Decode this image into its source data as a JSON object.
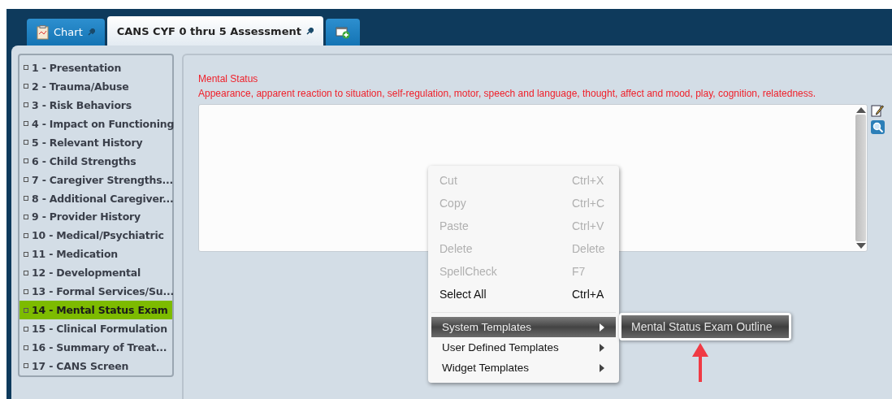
{
  "tabs": [
    {
      "label": "Chart",
      "selected": false,
      "kind": "chart"
    },
    {
      "label": "CANS CYF 0 thru 5 Assessment",
      "selected": true,
      "kind": "form"
    },
    {
      "kind": "add",
      "selected": false
    }
  ],
  "sidebar": {
    "items": [
      {
        "label": "1 - Presentation",
        "selected": false
      },
      {
        "label": "2 - Trauma/Abuse",
        "selected": false
      },
      {
        "label": "3 - Risk Behaviors",
        "selected": false
      },
      {
        "label": "4 - Impact on Functioning",
        "selected": false
      },
      {
        "label": "5 - Relevant History",
        "selected": false
      },
      {
        "label": "6 - Child Strengths",
        "selected": false
      },
      {
        "label": "7 - Caregiver Strengths...",
        "selected": false
      },
      {
        "label": "8 - Additional Caregiver...",
        "selected": false
      },
      {
        "label": "9 - Provider History",
        "selected": false
      },
      {
        "label": "10 - Medical/Psychiatric",
        "selected": false
      },
      {
        "label": "11 - Medication",
        "selected": false
      },
      {
        "label": "12 - Developmental",
        "selected": false
      },
      {
        "label": "13 - Formal Services/Su...",
        "selected": false
      },
      {
        "label": "14 - Mental Status Exam",
        "selected": true
      },
      {
        "label": "15 - Clinical Formulation",
        "selected": false
      },
      {
        "label": "16 - Summary of Treat...",
        "selected": false
      },
      {
        "label": "17 - CANS Screen",
        "selected": false
      }
    ]
  },
  "section": {
    "title": "Mental Status",
    "description": "Appearance, apparent reaction to situation, self-regulation, motor, speech and language, thought, affect and mood, play, cognition, relatedness."
  },
  "context_menu": {
    "items": [
      {
        "kind": "command",
        "label": "Cut",
        "shortcut": "Ctrl+X",
        "disabled": true,
        "selected": false
      },
      {
        "kind": "command",
        "label": "Copy",
        "shortcut": "Ctrl+C",
        "disabled": true,
        "selected": false
      },
      {
        "kind": "command",
        "label": "Paste",
        "shortcut": "Ctrl+V",
        "disabled": true,
        "selected": false
      },
      {
        "kind": "command",
        "label": "Delete",
        "shortcut": "Delete",
        "disabled": true,
        "selected": false
      },
      {
        "kind": "command",
        "label": "SpellCheck",
        "shortcut": "F7",
        "disabled": true,
        "selected": false
      },
      {
        "kind": "command",
        "label": "Select All",
        "shortcut": "Ctrl+A",
        "disabled": false,
        "selected": false
      },
      {
        "kind": "submenu",
        "label": "System Templates",
        "disabled": false,
        "selected": true
      },
      {
        "kind": "submenu",
        "label": "User Defined Templates",
        "disabled": false,
        "selected": false
      },
      {
        "kind": "submenu",
        "label": "Widget Templates",
        "disabled": false,
        "selected": false
      }
    ]
  },
  "submenu": {
    "items": [
      {
        "label": "Mental Status Exam Outline",
        "selected": true
      }
    ]
  }
}
